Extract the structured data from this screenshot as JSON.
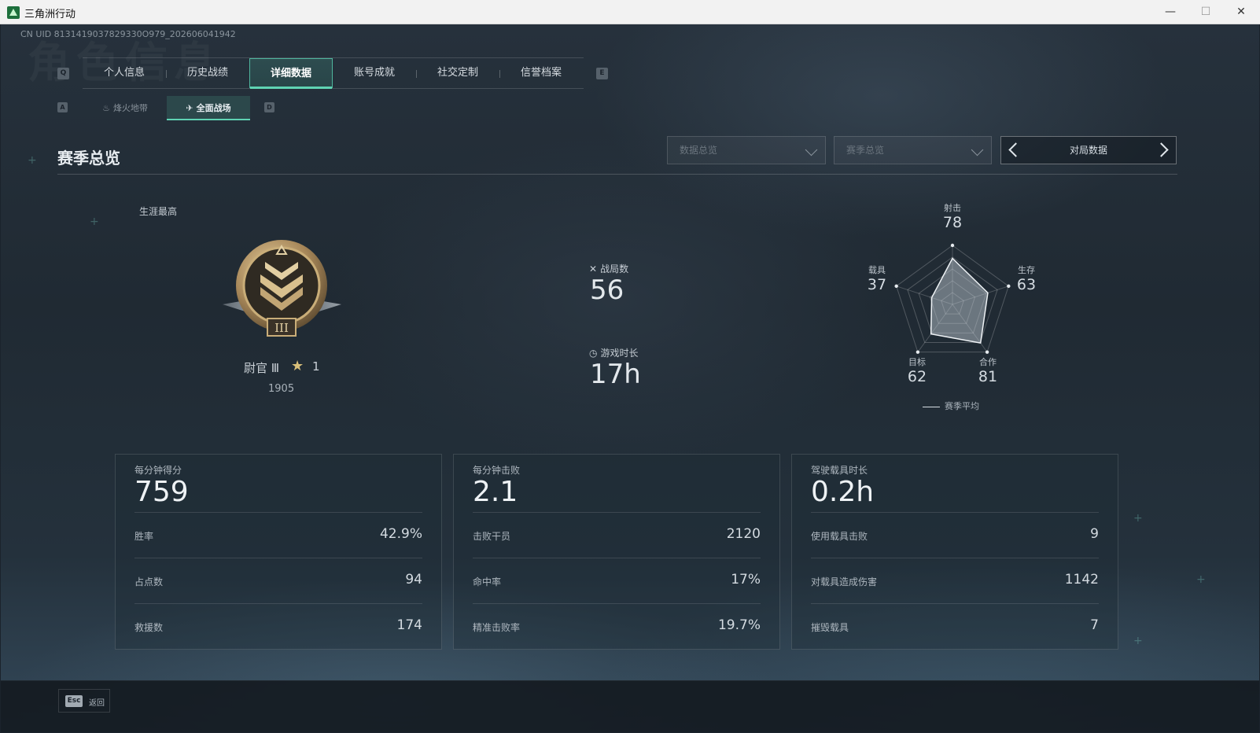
{
  "window": {
    "title": "三角洲行动"
  },
  "uid": "CN UID 8131419037829330O979_202606041942",
  "bg_title": "角色信息",
  "tabs": {
    "left_key": "Q",
    "right_key": "E",
    "items": [
      {
        "label": "个人信息",
        "active": false
      },
      {
        "label": "历史战绩",
        "active": false
      },
      {
        "label": "详细数据",
        "active": true
      },
      {
        "label": "账号成就",
        "active": false
      },
      {
        "label": "社交定制",
        "active": false
      },
      {
        "label": "信誉档案",
        "active": false
      }
    ]
  },
  "subtabs": {
    "left_key": "A",
    "right_key": "D",
    "items": [
      {
        "label": "烽火地带",
        "active": false
      },
      {
        "label": "全面战场",
        "active": true
      }
    ]
  },
  "section": {
    "title": "赛季总览",
    "dropdown1": "数据总览",
    "dropdown2": "赛季总览",
    "pager_label": "对局数据"
  },
  "rank": {
    "career_label": "生涯最高",
    "name": "尉官 Ⅲ",
    "stars": "1",
    "score": "1905"
  },
  "summary": {
    "matches_label": "战局数",
    "matches_value": "56",
    "playtime_label": "游戏时长",
    "playtime_value": "17h"
  },
  "radar": {
    "axes": [
      {
        "label": "射击",
        "value": "78"
      },
      {
        "label": "生存",
        "value": "63"
      },
      {
        "label": "合作",
        "value": "81"
      },
      {
        "label": "目标",
        "value": "62"
      },
      {
        "label": "载具",
        "value": "37"
      }
    ],
    "values": [
      78,
      63,
      81,
      62,
      37
    ],
    "max": 100,
    "legend": "赛季平均"
  },
  "cards": [
    {
      "title": "每分钟得分",
      "value": "759",
      "rows": [
        {
          "label": "胜率",
          "value": "42.9%"
        },
        {
          "label": "占点数",
          "value": "94"
        },
        {
          "label": "救援数",
          "value": "174"
        }
      ]
    },
    {
      "title": "每分钟击败",
      "value": "2.1",
      "rows": [
        {
          "label": "击败干员",
          "value": "2120"
        },
        {
          "label": "命中率",
          "value": "17%"
        },
        {
          "label": "精准击败率",
          "value": "19.7%"
        }
      ]
    },
    {
      "title": "驾驶载具时长",
      "value": "0.2h",
      "rows": [
        {
          "label": "使用载具击败",
          "value": "9"
        },
        {
          "label": "对载具造成伤害",
          "value": "1142"
        },
        {
          "label": "摧毁载具",
          "value": "7"
        }
      ]
    }
  ],
  "footer": {
    "esc_key": "Esc",
    "back_label": "返回"
  },
  "colors": {
    "accent": "#5fd3b3",
    "bg": "#1f2932"
  }
}
